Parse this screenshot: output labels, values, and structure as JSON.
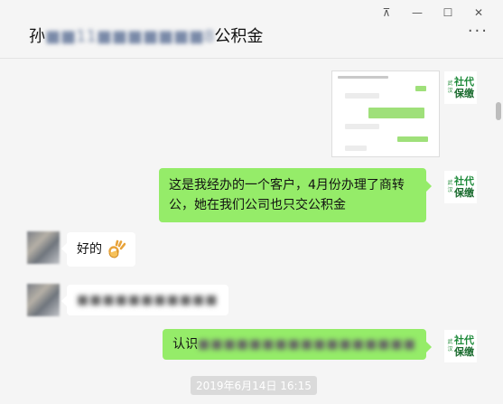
{
  "window_controls": {
    "pin": "⊼",
    "minimize": "—",
    "maximize": "☐",
    "close": "✕"
  },
  "header": {
    "title_prefix": "孙",
    "title_blurred": "■■11■■■■■■■8",
    "title_suffix": "公积金",
    "more": "···"
  },
  "messages": {
    "m2_text": "这是我经办的一个客户，4月份办理了商转公，她在我们公司也只交公积金",
    "m3_text": "好的",
    "m4_blurred": "■■■■■■■■■■■",
    "m5_prefix": "认识",
    "m5_blurred": "■■■■■■■■■■■■■■■■■"
  },
  "logo": {
    "small": "武汉",
    "line1": "社代",
    "line2": "保缴"
  },
  "timestamp": "2019年6月14日 16:15",
  "colors": {
    "bubble_self": "#95ec69",
    "bubble_other": "#ffffff",
    "background": "#f5f5f5",
    "logo_green": "#1e8a3a"
  }
}
